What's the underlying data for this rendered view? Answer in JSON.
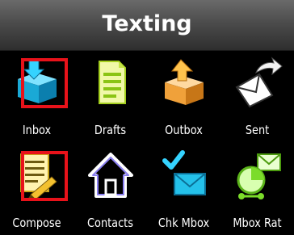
{
  "header": {
    "title": "Texting"
  },
  "menu": {
    "items": [
      {
        "label": "Inbox",
        "icon": "inbox-icon",
        "highlighted": true
      },
      {
        "label": "Drafts",
        "icon": "drafts-icon",
        "highlighted": false
      },
      {
        "label": "Outbox",
        "icon": "outbox-icon",
        "highlighted": false
      },
      {
        "label": "Sent",
        "icon": "sent-icon",
        "highlighted": false
      },
      {
        "label": "Compose",
        "icon": "compose-icon",
        "highlighted": true
      },
      {
        "label": "Contacts",
        "icon": "contacts-icon",
        "highlighted": false
      },
      {
        "label": "Chk Mbox",
        "icon": "check-mailbox-icon",
        "highlighted": false
      },
      {
        "label": "Mbox Rat",
        "icon": "mailbox-rate-icon",
        "highlighted": false
      }
    ]
  },
  "colors": {
    "highlight": "#e8121a",
    "accent_cyan": "#22c3e6",
    "accent_yellow": "#f3d21e",
    "accent_green": "#7bdc2a"
  }
}
